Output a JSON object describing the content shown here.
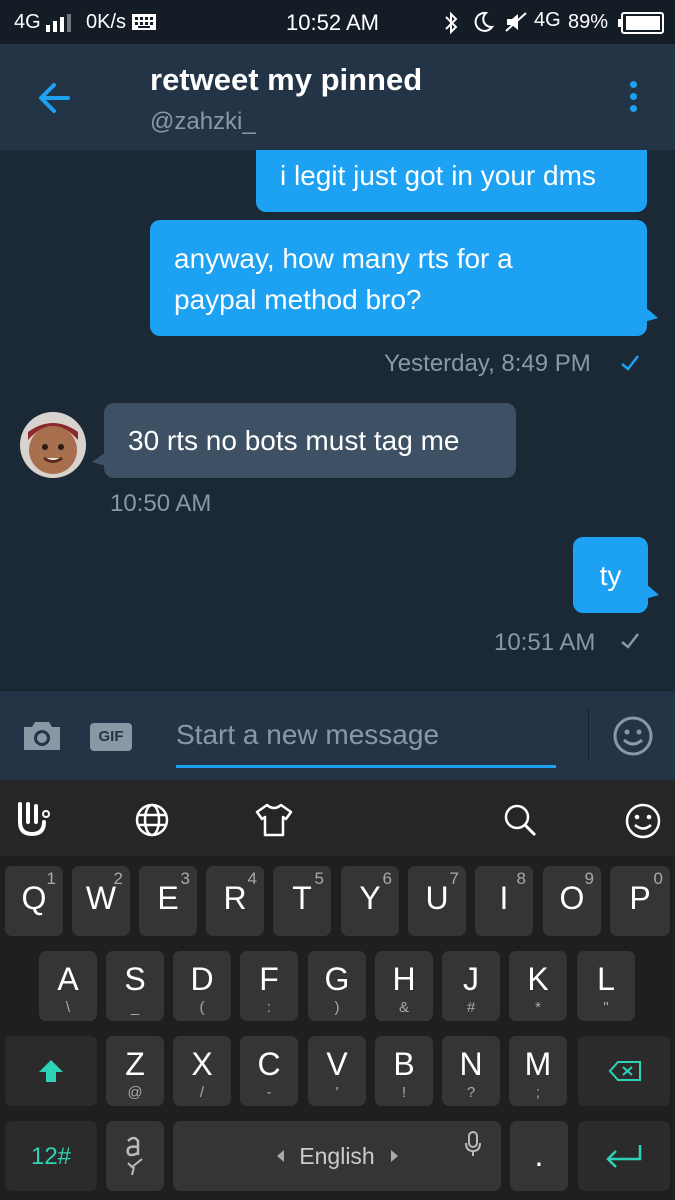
{
  "status_bar": {
    "network": "4G",
    "speed": "0K/s",
    "time": "10:52 AM",
    "network2": "4G",
    "battery": "89%"
  },
  "header": {
    "title": "retweet my pinned",
    "handle": "@zahzki_"
  },
  "messages": [
    {
      "text_lines": [
        "i legit just got in your dms"
      ]
    },
    {
      "text_lines": [
        "anyway, how many rts for a",
        "paypal method bro?"
      ],
      "timestamp": "Yesterday, 8:49 PM"
    },
    {
      "text_lines": [
        "30 rts no bots must tag me"
      ],
      "timestamp": "10:50 AM"
    },
    {
      "text_lines": [
        "ty"
      ],
      "timestamp": "10:51 AM"
    }
  ],
  "composer": {
    "gif_label": "GIF",
    "placeholder": "Start a new message"
  },
  "keyboard": {
    "row1": [
      {
        "main": "Q",
        "sub": "1"
      },
      {
        "main": "W",
        "sub": "2"
      },
      {
        "main": "E",
        "sub": "3"
      },
      {
        "main": "R",
        "sub": "4"
      },
      {
        "main": "T",
        "sub": "5"
      },
      {
        "main": "Y",
        "sub": "6"
      },
      {
        "main": "U",
        "sub": "7"
      },
      {
        "main": "I",
        "sub": "8"
      },
      {
        "main": "O",
        "sub": "9"
      },
      {
        "main": "P",
        "sub": "0"
      }
    ],
    "row2": [
      {
        "main": "A",
        "sub": "\\"
      },
      {
        "main": "S",
        "sub": "_"
      },
      {
        "main": "D",
        "sub": "("
      },
      {
        "main": "F",
        "sub": ":"
      },
      {
        "main": "G",
        "sub": ")"
      },
      {
        "main": "H",
        "sub": "&"
      },
      {
        "main": "J",
        "sub": "#"
      },
      {
        "main": "K",
        "sub": "*"
      },
      {
        "main": "L",
        "sub": "\""
      }
    ],
    "row3": [
      {
        "main": "Z",
        "sub": "@"
      },
      {
        "main": "X",
        "sub": "/"
      },
      {
        "main": "C",
        "sub": "-"
      },
      {
        "main": "V",
        "sub": "'"
      },
      {
        "main": "B",
        "sub": "!"
      },
      {
        "main": "N",
        "sub": "?"
      },
      {
        "main": "M",
        "sub": ";"
      }
    ],
    "symbols_key": "12#",
    "space_label": "English",
    "period_key": "."
  },
  "colors": {
    "accent": "#1da1f2",
    "background": "#1b2836",
    "header": "#243447"
  }
}
